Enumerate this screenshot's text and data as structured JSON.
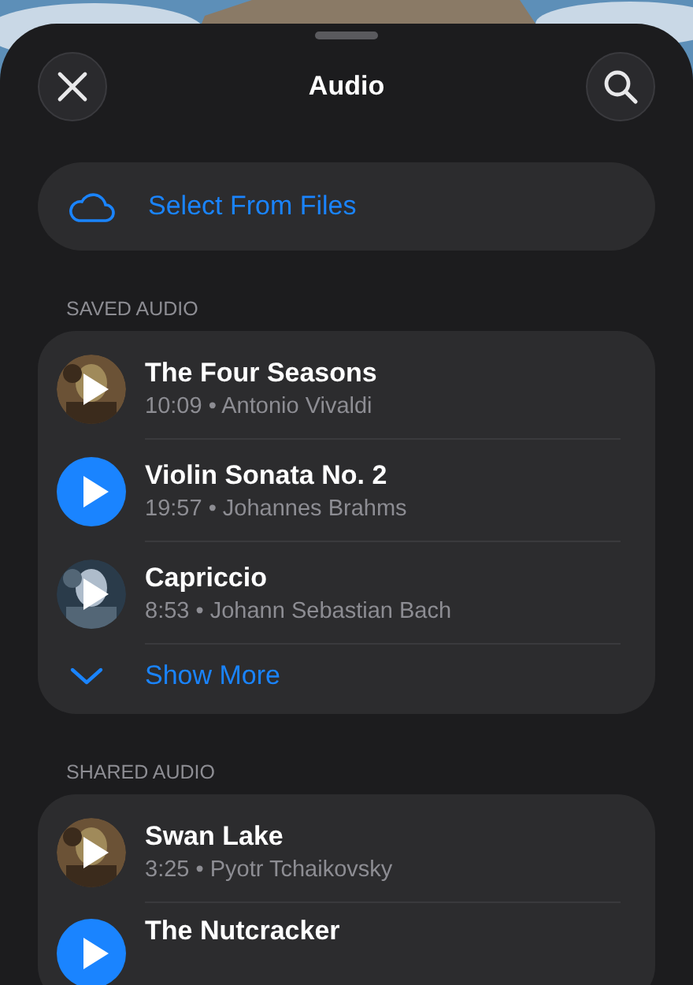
{
  "header": {
    "title": "Audio"
  },
  "select_from_files": {
    "label": "Select From Files"
  },
  "sections": [
    {
      "heading": "SAVED AUDIO",
      "items": [
        {
          "title": "The Four Seasons",
          "details": "10:09 • Antonio Vivaldi",
          "kind": "picture"
        },
        {
          "title": "Violin Sonata No. 2",
          "details": "19:57 • Johannes Brahms",
          "kind": "plain"
        },
        {
          "title": "Capriccio",
          "details": "8:53 • Johann Sebastian Bach",
          "kind": "picture"
        }
      ],
      "show_more": "Show More"
    },
    {
      "heading": "SHARED AUDIO",
      "items": [
        {
          "title": "Swan Lake",
          "details": "3:25 • Pyotr Tchaikovsky",
          "kind": "picture"
        },
        {
          "title": "The Nutcracker",
          "kind": "plain"
        }
      ]
    }
  ]
}
